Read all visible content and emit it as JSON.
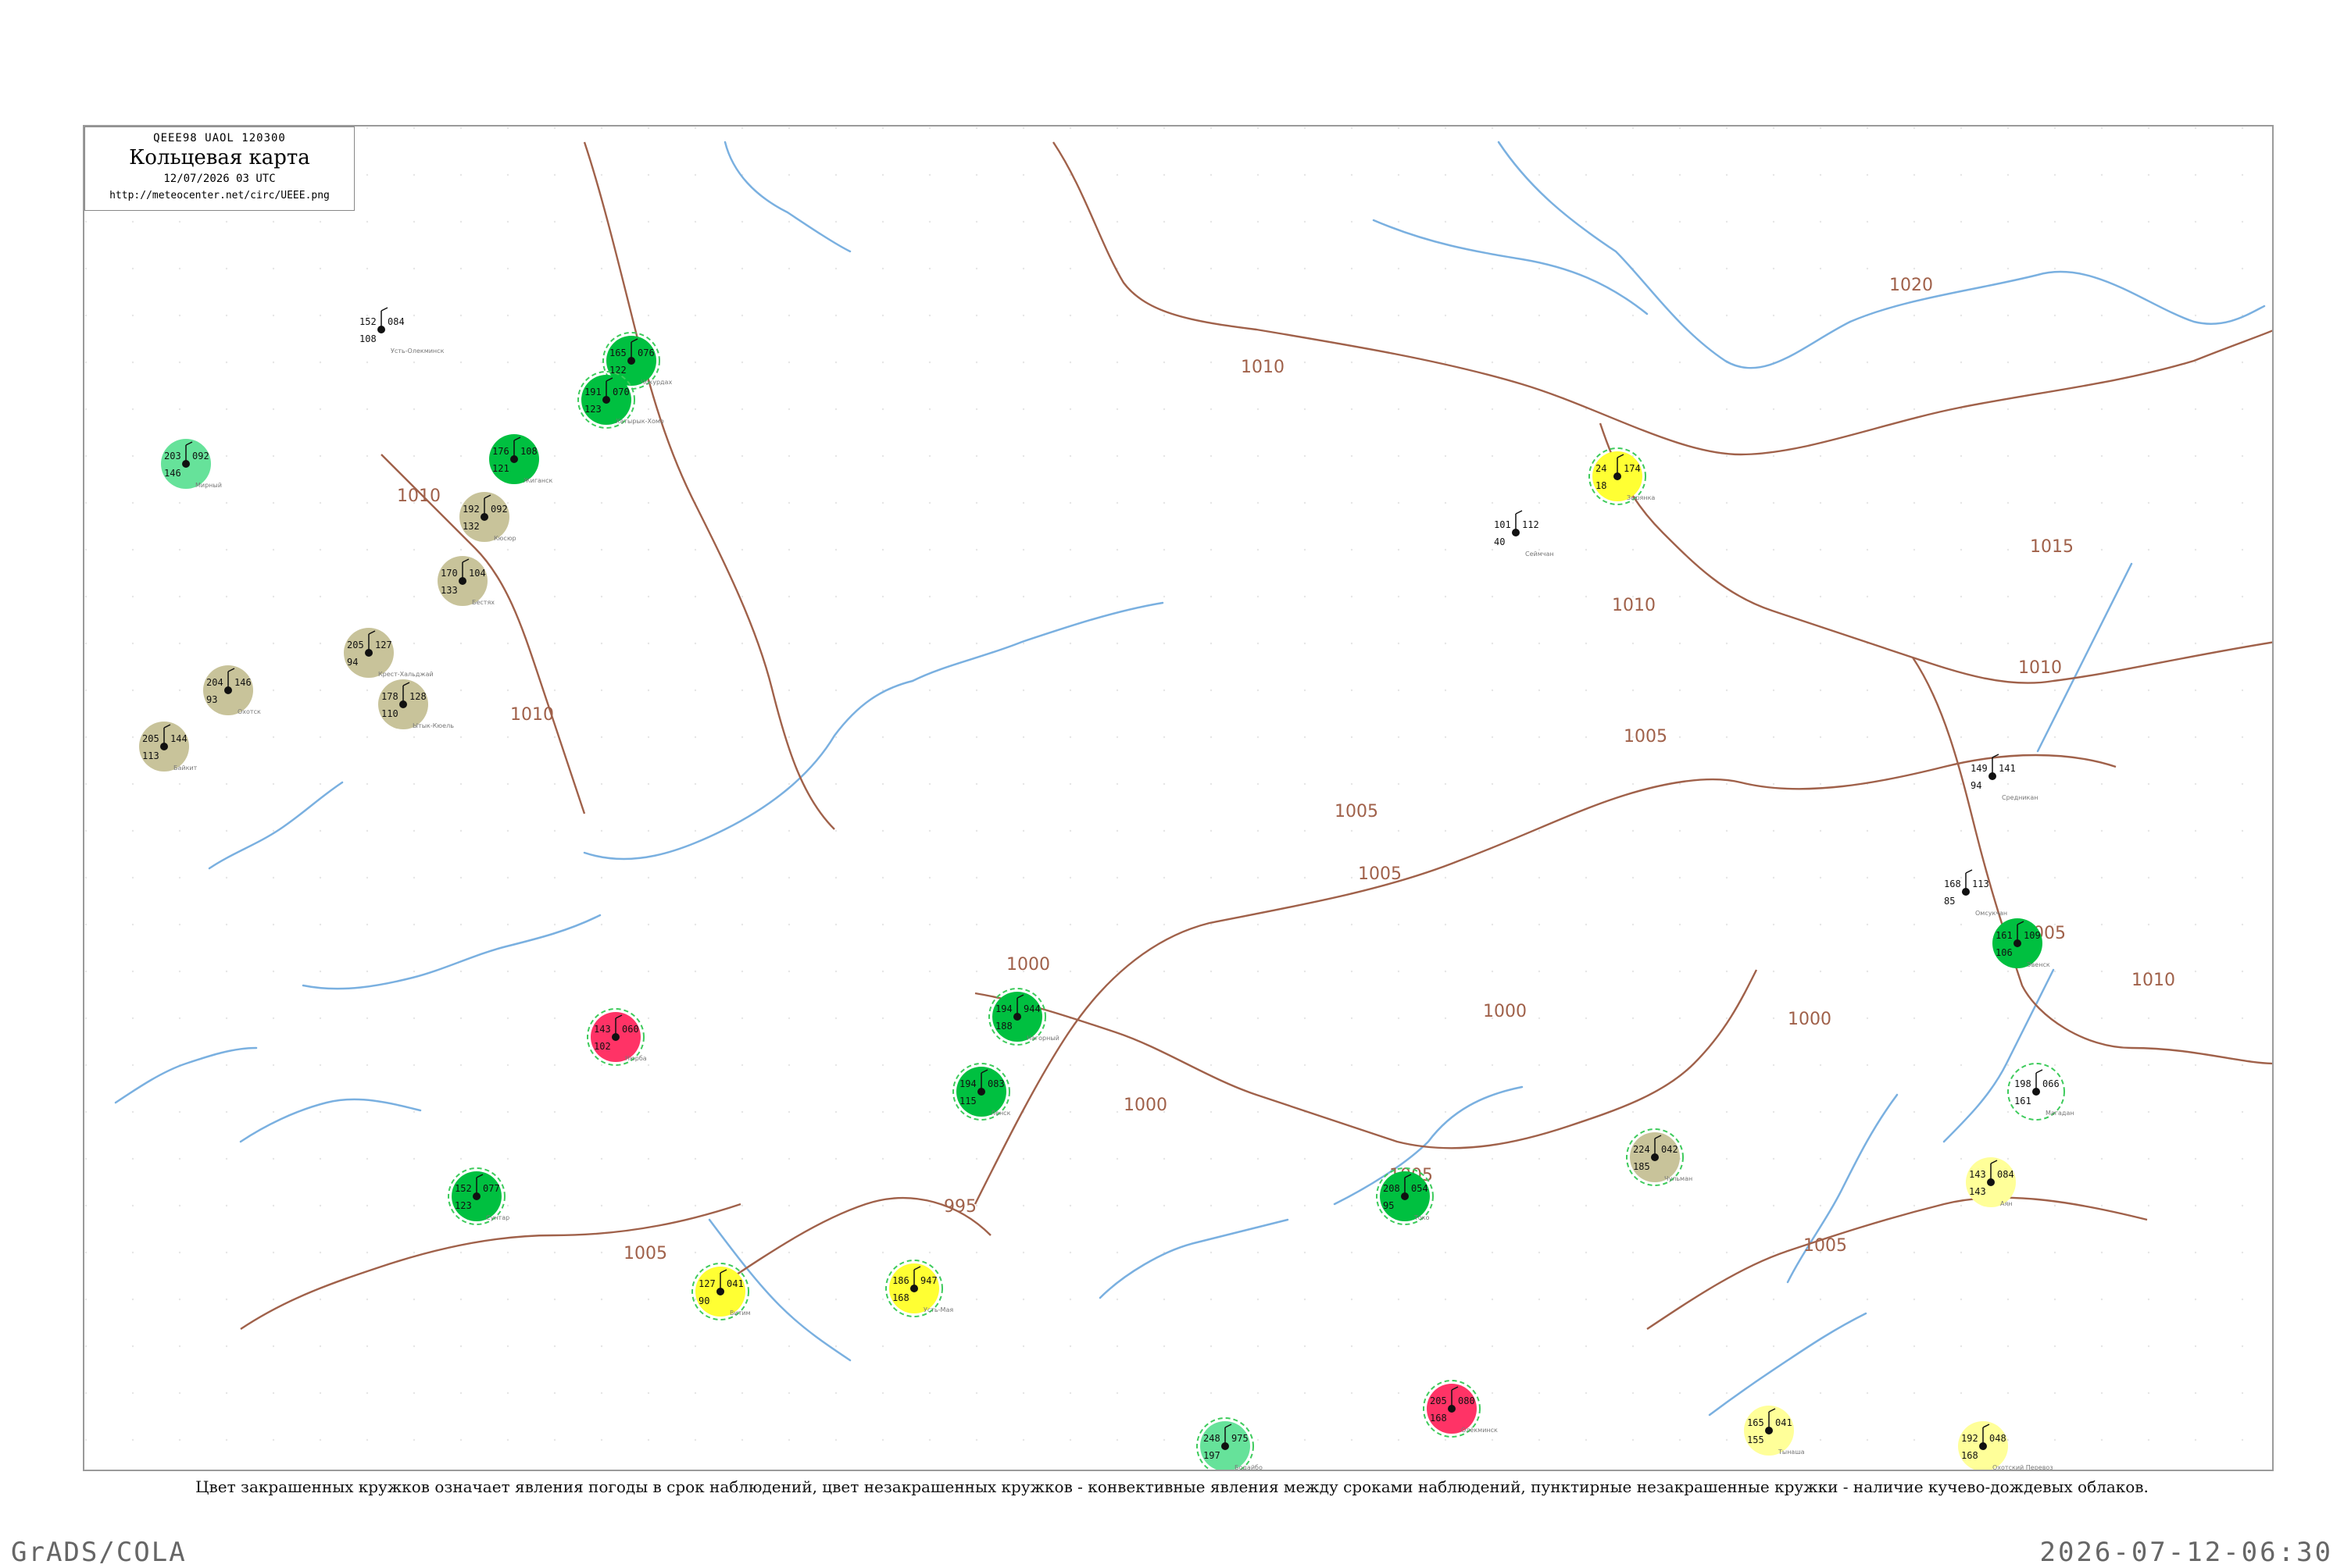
{
  "header": {
    "code_line": "QEEE98 UAOL 120300",
    "title": "Кольцевая карта",
    "date_line": "12/07/2026 03 UTC",
    "url": "http://meteocenter.net/circ/UEEE.png"
  },
  "caption": "Цвет закрашенных кружков означает явления погоды в срок наблюдений, цвет незакрашенных кружков - конвективные явления между сроками наблюдений, пунктирные незакрашенные кружки - наличие кучево-дождевых облаков.",
  "footer": {
    "left": "GrADS/COLA",
    "right": "2026-07-12-06:30"
  },
  "colors": {
    "isobar": "#a0614a",
    "river": "#7ab0e0",
    "green_fill": "#00c040",
    "light_green_fill": "#66e29a",
    "olive_fill": "#c8c39a",
    "yellow_fill": "#ffff33",
    "light_yellow_fill": "#ffff99",
    "red_fill": "#ff3366",
    "dashed_ring": "#3ecb5c"
  },
  "isobar_labels": [
    "1020",
    "1010",
    "1015",
    "1010",
    "1010",
    "1005",
    "1005",
    "1010",
    "1010",
    "1005",
    "1000",
    "1000",
    "1000",
    "1005",
    "995",
    "1005",
    "1000",
    "1010",
    "1005",
    "1005"
  ],
  "stations": [
    {
      "name": "Усть-Олекминск",
      "fill": "none",
      "dashed": false,
      "temp": "152",
      "pres": "084",
      "dew": "108"
    },
    {
      "name": "Чокурдах",
      "fill": "green",
      "dashed": true,
      "temp": "165",
      "pres": "076",
      "dew": "122"
    },
    {
      "name": "Хатырык-Хомо",
      "fill": "green",
      "dashed": true,
      "temp": "191",
      "pres": "070",
      "dew": "123"
    },
    {
      "name": "Жиганск",
      "fill": "green",
      "dashed": false,
      "temp": "176",
      "pres": "108",
      "dew": "121"
    },
    {
      "name": "Кюсюр",
      "fill": "olive",
      "dashed": false,
      "temp": "192",
      "pres": "092",
      "dew": "132"
    },
    {
      "name": "Бестях",
      "fill": "olive",
      "dashed": false,
      "temp": "170",
      "pres": "104",
      "dew": "133"
    },
    {
      "name": "Крест-Хальджай",
      "fill": "olive",
      "dashed": false,
      "temp": "205",
      "pres": "127",
      "dew": "94"
    },
    {
      "name": "Ытык-Кюель",
      "fill": "olive",
      "dashed": false,
      "temp": "178",
      "pres": "128",
      "dew": "110"
    },
    {
      "name": "Охотск",
      "fill": "olive",
      "dashed": false,
      "temp": "204",
      "pres": "146",
      "dew": "93"
    },
    {
      "name": "Байкит",
      "fill": "olive",
      "dashed": false,
      "temp": "205",
      "pres": "144",
      "dew": "113"
    },
    {
      "name": "Мирный",
      "fill": "lightgreen",
      "dashed": false,
      "temp": "203",
      "pres": "092",
      "dew": "146"
    },
    {
      "name": "Зырянка",
      "fill": "yellow",
      "dashed": true,
      "temp": "24",
      "pres": "174",
      "dew": "18"
    },
    {
      "name": "Сеймчан",
      "fill": "none",
      "dashed": false,
      "temp": "101",
      "pres": "112",
      "dew": "40"
    },
    {
      "name": "Средникан",
      "fill": "none",
      "dashed": false,
      "temp": "149",
      "pres": "141",
      "dew": "94"
    },
    {
      "name": "Омсукчан",
      "fill": "none",
      "dashed": false,
      "temp": "168",
      "pres": "113",
      "dew": "85"
    },
    {
      "name": "Эвенск",
      "fill": "green",
      "dashed": false,
      "temp": "161",
      "pres": "109",
      "dew": "106"
    },
    {
      "name": "Магадан",
      "fill": "none",
      "dashed": true,
      "temp": "198",
      "pres": "066",
      "dew": "161"
    },
    {
      "name": "Аян",
      "fill": "lightyellow",
      "dashed": false,
      "temp": "143",
      "pres": "084",
      "dew": "143"
    },
    {
      "name": "Тынаша",
      "fill": "lightyellow",
      "dashed": false,
      "temp": "165",
      "pres": "041",
      "dew": "155"
    },
    {
      "name": "Нюрба",
      "fill": "red",
      "dashed": true,
      "temp": "143",
      "pres": "060",
      "dew": "102"
    },
    {
      "name": "Олёкминск",
      "fill": "red",
      "dashed": true,
      "temp": "205",
      "pres": "080",
      "dew": "168"
    },
    {
      "name": "Витим",
      "fill": "yellow",
      "dashed": true,
      "temp": "127",
      "pres": "041",
      "dew": "90"
    },
    {
      "name": "Усть-Мая",
      "fill": "yellow",
      "dashed": true,
      "temp": "186",
      "pres": "947",
      "dew": "168"
    },
    {
      "name": "Чульман",
      "fill": "olive",
      "dashed": true,
      "temp": "224",
      "pres": "042",
      "dew": "185"
    },
    {
      "name": "Токо",
      "fill": "green",
      "dashed": true,
      "temp": "208",
      "pres": "054",
      "dew": "95"
    },
    {
      "name": "Нагорный",
      "fill": "green",
      "dashed": true,
      "temp": "194",
      "pres": "944",
      "dew": "188"
    },
    {
      "name": "Ленск",
      "fill": "green",
      "dashed": true,
      "temp": "194",
      "pres": "083",
      "dew": "115"
    },
    {
      "name": "Сунтар",
      "fill": "green",
      "dashed": true,
      "temp": "152",
      "pres": "077",
      "dew": "123"
    },
    {
      "name": "Бодайбо",
      "fill": "lightgreen",
      "dashed": true,
      "temp": "248",
      "pres": "975",
      "dew": "197"
    },
    {
      "name": "Охотский Перевоз",
      "fill": "lightyellow",
      "dashed": false,
      "temp": "192",
      "pres": "048",
      "dew": "168"
    }
  ]
}
